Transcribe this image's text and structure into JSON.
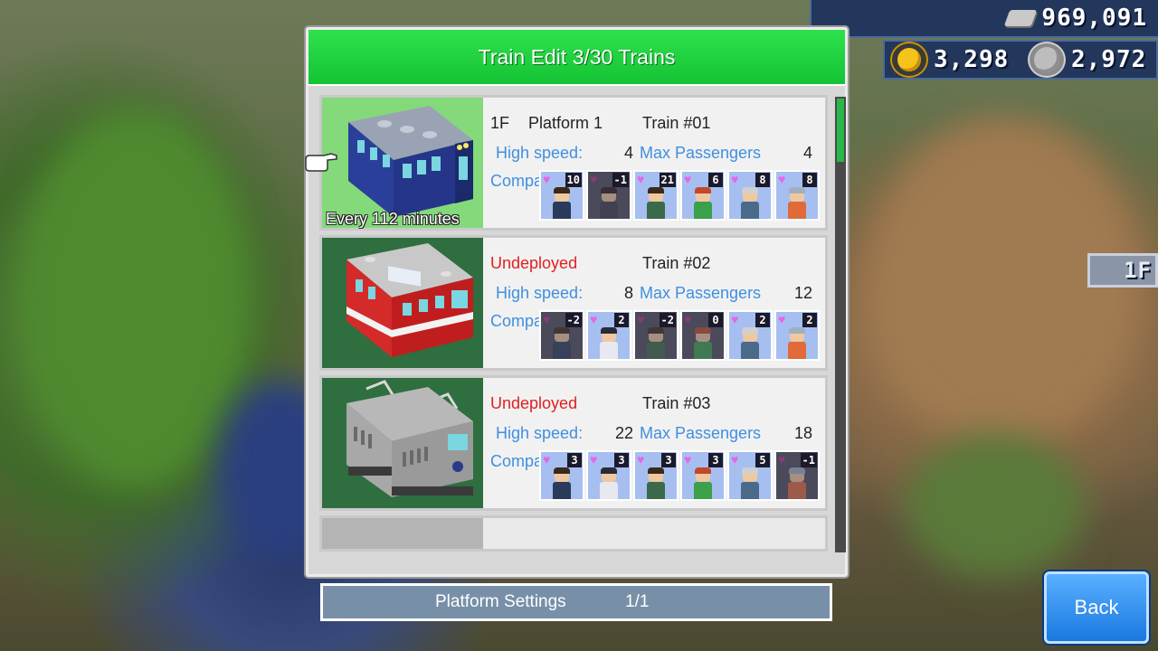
{
  "hud": {
    "train_money": "969,091",
    "research_points": "3,298",
    "silver_coins": "2,972",
    "floor_tag": "1F"
  },
  "panel": {
    "title": "Train Edit 3/30 Trains"
  },
  "labels": {
    "high_speed": "High speed:",
    "max_passengers": "Max Passengers",
    "company": "Compa"
  },
  "trains": [
    {
      "status": "1F",
      "platform": "Platform 1",
      "train_no": "Train #01",
      "interval": "Every  112  minutes",
      "high_speed": "4",
      "max_passengers": "4",
      "deployed": true,
      "crew": [
        {
          "affinity": "10",
          "active": true,
          "hair": "#3a2a1a",
          "body": "#2a3a5a"
        },
        {
          "affinity": "-1",
          "active": false,
          "hair": "#2a1a1a",
          "body": "#3a3a4a"
        },
        {
          "affinity": "21",
          "active": true,
          "hair": "#3a2a1a",
          "body": "#3a6a4a"
        },
        {
          "affinity": "6",
          "active": true,
          "hair": "#c04a2a",
          "body": "#3aa04a"
        },
        {
          "affinity": "8",
          "active": true,
          "hair": "#d0d0d0",
          "body": "#4a6a8a"
        },
        {
          "affinity": "8",
          "active": true,
          "hair": "#a0b0c0",
          "body": "#e06a3a"
        }
      ]
    },
    {
      "status": "Undeployed",
      "platform": "",
      "train_no": "Train #02",
      "interval": "",
      "high_speed": "8",
      "max_passengers": "12",
      "deployed": false,
      "crew": [
        {
          "affinity": "-2",
          "active": false,
          "hair": "#3a2a1a",
          "body": "#2a3a5a"
        },
        {
          "affinity": "2",
          "active": true,
          "hair": "#2a2a3a",
          "body": "#e8e8f0"
        },
        {
          "affinity": "-2",
          "active": false,
          "hair": "#3a2a1a",
          "body": "#3a6a4a"
        },
        {
          "affinity": "0",
          "active": false,
          "hair": "#c04a2a",
          "body": "#3aa04a"
        },
        {
          "affinity": "2",
          "active": true,
          "hair": "#d0d0d0",
          "body": "#4a6a8a"
        },
        {
          "affinity": "2",
          "active": true,
          "hair": "#a0b0c0",
          "body": "#e06a3a"
        }
      ]
    },
    {
      "status": "Undeployed",
      "platform": "",
      "train_no": "Train #03",
      "interval": "",
      "high_speed": "22",
      "max_passengers": "18",
      "deployed": false,
      "crew": [
        {
          "affinity": "3",
          "active": true,
          "hair": "#3a2a1a",
          "body": "#2a3a5a"
        },
        {
          "affinity": "3",
          "active": true,
          "hair": "#2a2a3a",
          "body": "#e8e8f0"
        },
        {
          "affinity": "3",
          "active": true,
          "hair": "#3a2a1a",
          "body": "#3a6a4a"
        },
        {
          "affinity": "3",
          "active": true,
          "hair": "#c04a2a",
          "body": "#3aa04a"
        },
        {
          "affinity": "5",
          "active": true,
          "hair": "#d0d0d0",
          "body": "#4a6a8a"
        },
        {
          "affinity": "-1",
          "active": false,
          "hair": "#a0b0c0",
          "body": "#e06a3a"
        }
      ]
    }
  ],
  "footer": {
    "platform_settings": "Platform Settings",
    "page": "1/1",
    "back": "Back"
  },
  "colors": {
    "header_green": "#14c334",
    "blue_label": "#3f8fe0",
    "undeployed_red": "#e02020",
    "back_blue": "#1a78e0"
  }
}
